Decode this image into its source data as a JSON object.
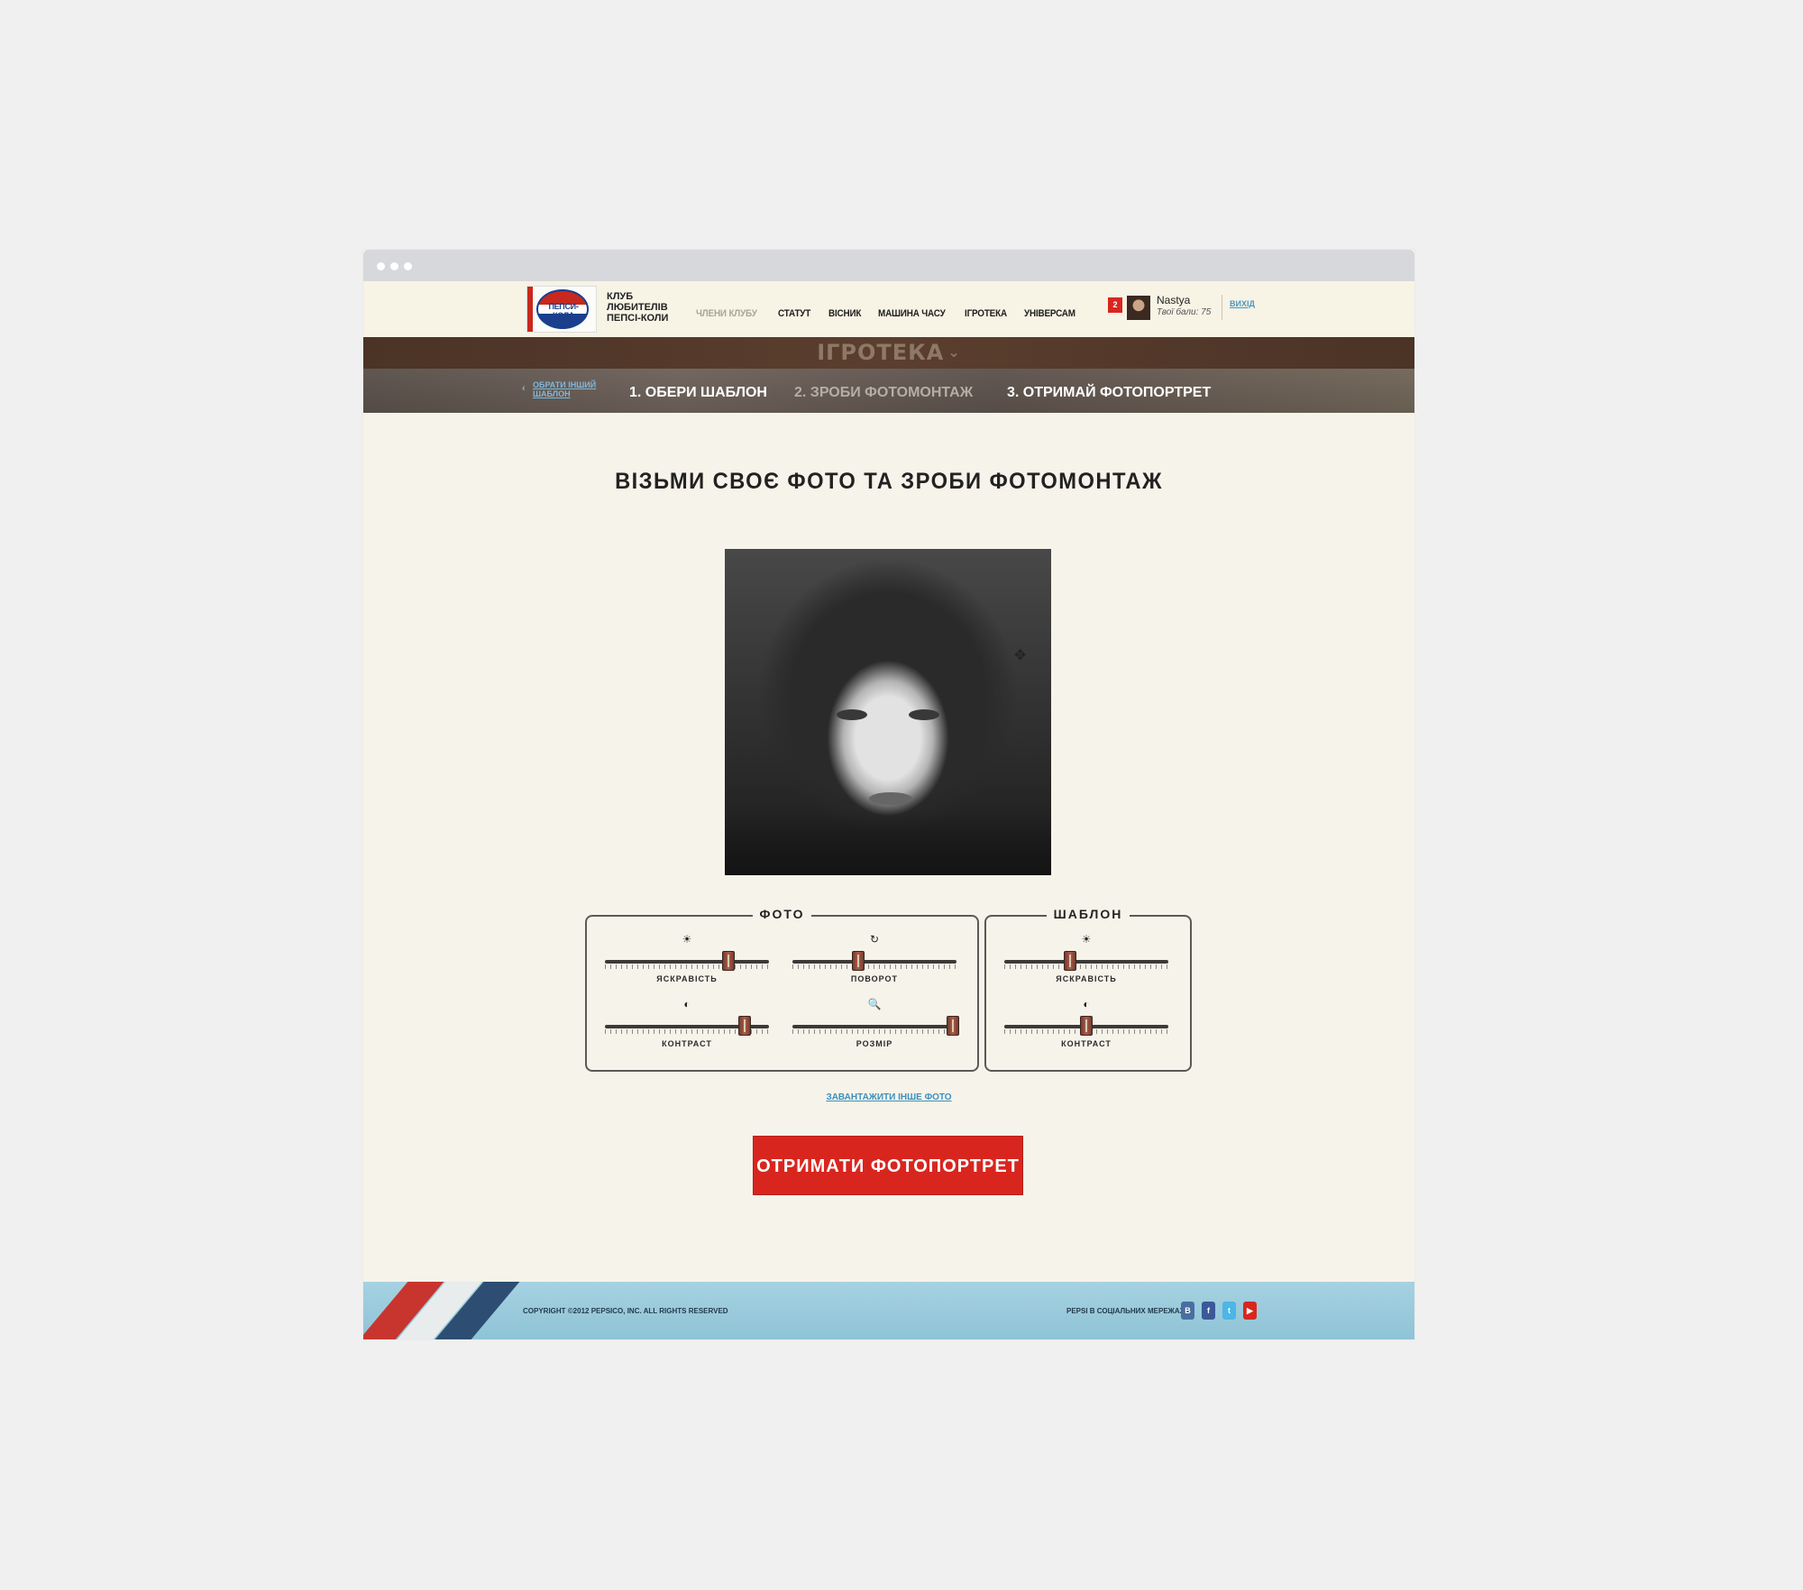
{
  "header": {
    "logo_text": "ПЕПСИ-КОЛА",
    "club_lines": [
      "КЛУБ",
      "ЛЮБИТЕЛІВ",
      "ПЕПСІ-КОЛИ"
    ],
    "nav": [
      "ЧЛЕНИ КЛУБУ",
      "СТАТУТ",
      "ВІСНИК",
      "МАШИНА ЧАСУ",
      "ІГРОТЕКА",
      "УНІВЕРСАМ"
    ],
    "notification_count": "2",
    "user_name": "Nastya",
    "user_balance": "Твої бали: 75",
    "logout": "ВИХІД"
  },
  "banner": {
    "title": "ІГРОТЕКА",
    "chevron": "⌄"
  },
  "steps": {
    "back": "ОБРАТИ ІНШИЙ ШАБЛОН",
    "back_icon": "‹",
    "items": [
      "1. ОБЕРИ ШАБЛОН",
      "2. ЗРОБИ ФОТОМОНТАЖ",
      "3. ОТРИМАЙ ФОТОПОРТРЕТ"
    ],
    "active_index": 1
  },
  "main": {
    "heading": "ВІЗЬМИ СВОЄ ФОТО ТА ЗРОБИ ФОТОМОНТАЖ",
    "move_icon": "✥",
    "photo_panel": {
      "title": "ФОТО",
      "sliders": [
        {
          "icon": "☀",
          "label": "ЯСКРАВІСТЬ",
          "level": 0.75
        },
        {
          "icon": "↻",
          "label": "ПОВОРОТ",
          "level": 0.4
        },
        {
          "icon": "◐",
          "label": "КОНТРАСТ",
          "level": 0.85
        },
        {
          "icon": "🔍",
          "label": "РОЗМІР",
          "level": 0.98
        }
      ]
    },
    "template_panel": {
      "title": "ШАБЛОН",
      "sliders": [
        {
          "icon": "☀",
          "label": "ЯСКРАВІСТЬ",
          "level": 0.4
        },
        {
          "icon": "◐",
          "label": "КОНТРАСТ",
          "level": 0.5
        }
      ]
    },
    "upload_link": "ЗАВАНТАЖИТИ ІНШЕ ФОТО",
    "cta": "ОТРИМАТИ ФОТОПОРТРЕТ"
  },
  "footer": {
    "copyright": "COPYRIGHT ©2012 PEPSICO, INC. ALL RIGHTS RESERVED",
    "social_label": "PEPSI В СОЦІАЛЬНИХ МЕРЕЖАХ:",
    "social": [
      {
        "name": "vk-icon",
        "glyph": "В",
        "color": "#4a6ea0"
      },
      {
        "name": "facebook-icon",
        "glyph": "f",
        "color": "#3b5998"
      },
      {
        "name": "twitter-icon",
        "glyph": "t",
        "color": "#4cb6e6"
      },
      {
        "name": "youtube-icon",
        "glyph": "▶",
        "color": "#d8261f"
      }
    ]
  },
  "colors": {
    "accent_red": "#d8261f",
    "link_blue": "#3d8fbd",
    "page_bg": "#f6f3ea"
  }
}
